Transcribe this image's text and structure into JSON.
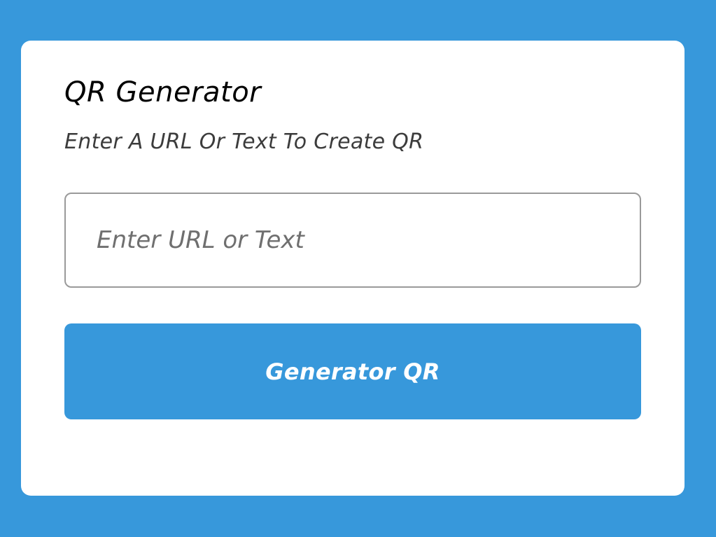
{
  "app": {
    "title": "QR Generator",
    "subtitle": "Enter A URL Or Text To Create QR"
  },
  "form": {
    "input_value": "",
    "input_placeholder": "Enter URL or Text",
    "button_label": "Generator QR"
  },
  "colors": {
    "page_background": "#3798db",
    "card_background": "#ffffff",
    "button_background": "#3798db",
    "button_text": "#ffffff",
    "input_border": "#9a9a9a",
    "placeholder_text": "#6f6f6f",
    "title_text": "#000000",
    "subtitle_text": "#3c3c3c"
  }
}
